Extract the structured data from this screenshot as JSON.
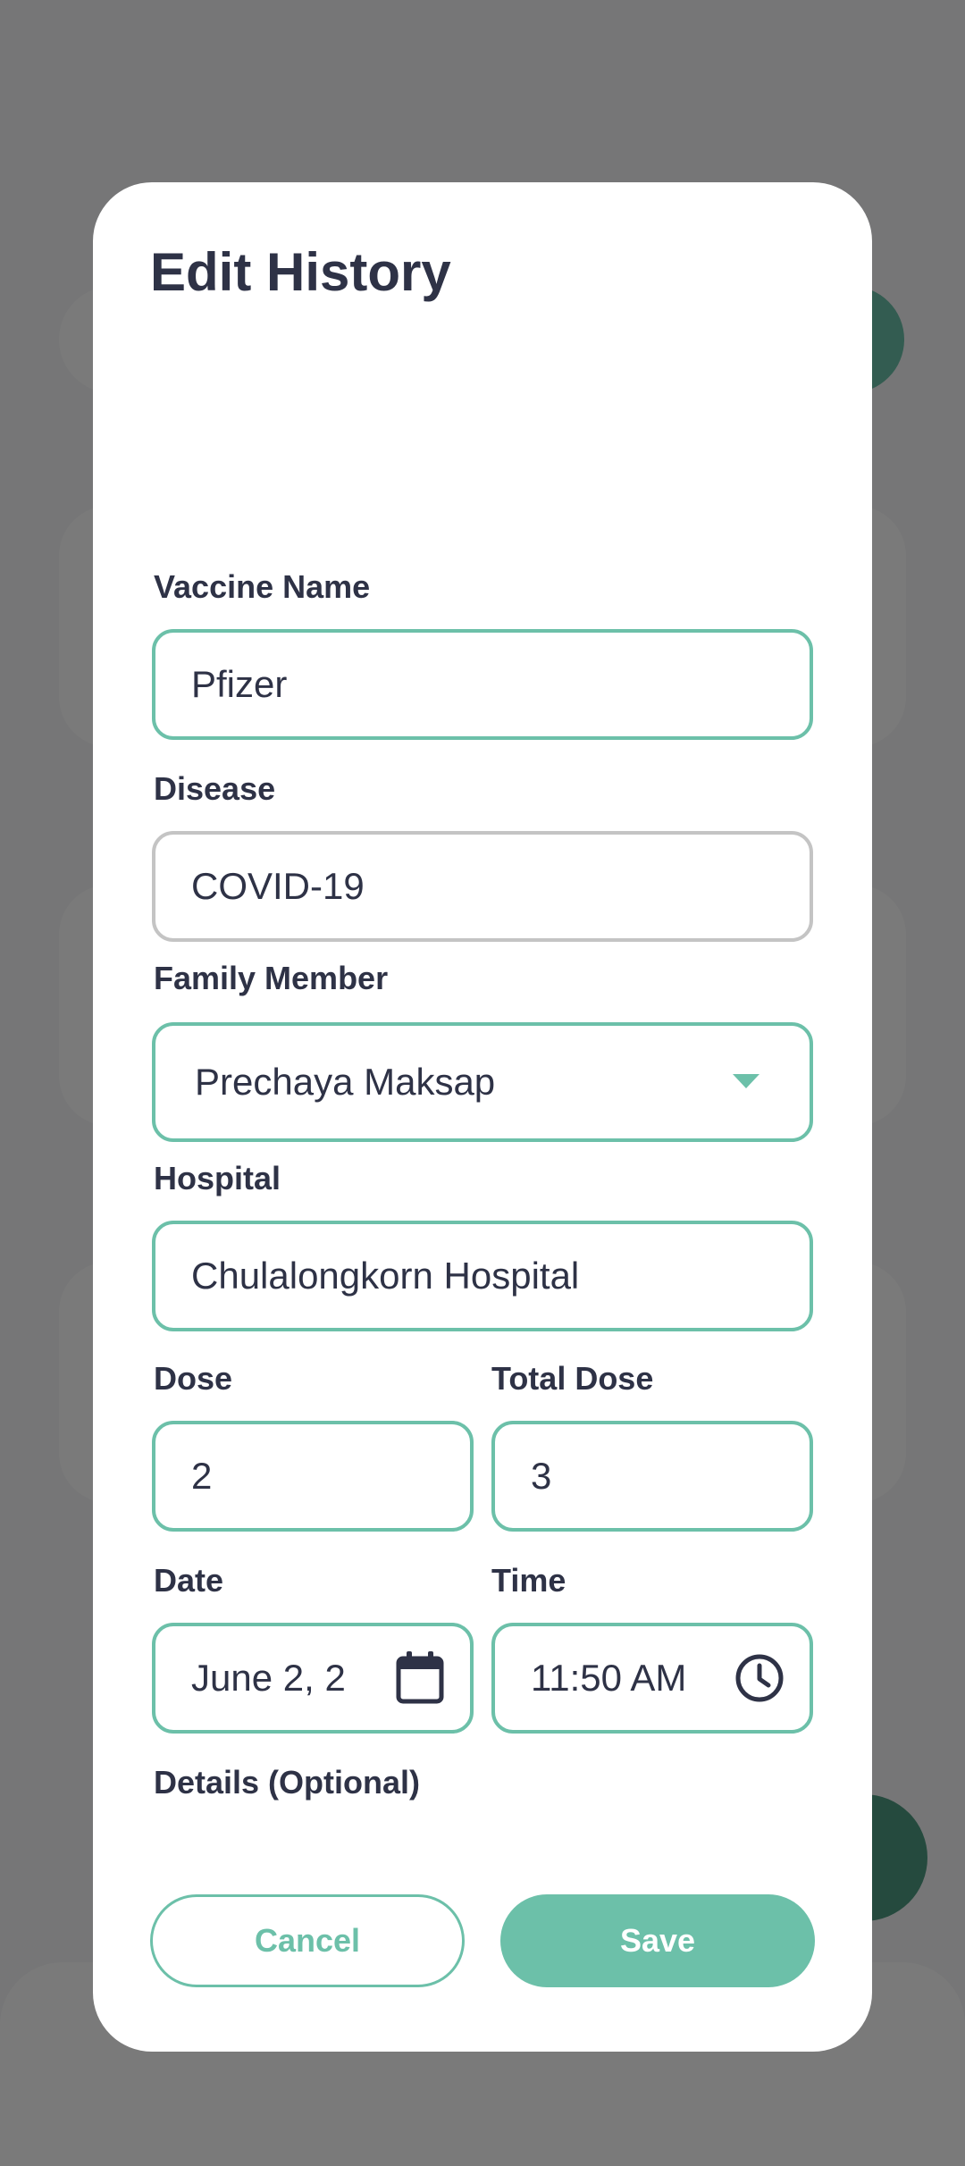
{
  "dialog": {
    "title": "Edit History",
    "fields": {
      "vaccine_name": {
        "label": "Vaccine Name",
        "value": "Pfizer"
      },
      "disease": {
        "label": "Disease",
        "value": "COVID-19"
      },
      "family_member": {
        "label": "Family Member",
        "value": "Prechaya Maksap"
      },
      "hospital": {
        "label": "Hospital",
        "value": "Chulalongkorn Hospital"
      },
      "dose": {
        "label": "Dose",
        "value": "2"
      },
      "total_dose": {
        "label": "Total Dose",
        "value": "3"
      },
      "date": {
        "label": "Date",
        "value": "June 2, 2"
      },
      "time": {
        "label": "Time",
        "value": "11:50 AM"
      },
      "details": {
        "label": "Details (Optional)",
        "value": ""
      }
    },
    "buttons": {
      "cancel": "Cancel",
      "save": "Save"
    }
  },
  "colors": {
    "accent": "#6cc0a9",
    "text": "#2e3246",
    "inactive_border": "#c4c4c4"
  },
  "icons": [
    "caret-down-icon",
    "calendar-icon",
    "clock-icon"
  ]
}
